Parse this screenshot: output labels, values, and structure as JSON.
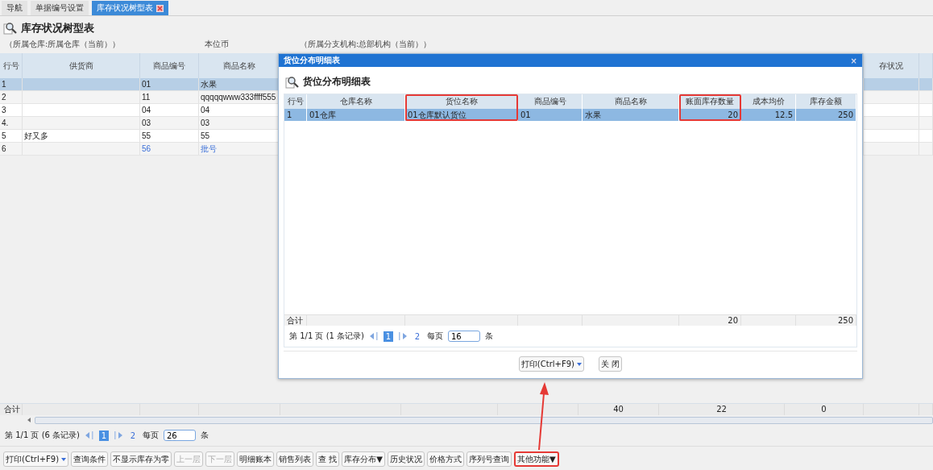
{
  "tabs": [
    {
      "label": "导航",
      "selected": false,
      "closable": false
    },
    {
      "label": "单据编号设置",
      "selected": false,
      "closable": false
    },
    {
      "label": "库存状况树型表",
      "selected": true,
      "closable": true
    }
  ],
  "page_title": "库存状况树型表",
  "filters": [
    "（所属仓库:所属仓库（当前））",
    "本位币",
    "（所属分支机构:总部机构（当前））"
  ],
  "main_table": {
    "columns": [
      {
        "label": "行号"
      },
      {
        "label": "供货商"
      },
      {
        "label": "商品编号"
      },
      {
        "label": "商品名称"
      },
      {},
      {},
      {},
      {},
      {},
      {},
      {
        "label": "存状况"
      },
      {}
    ],
    "rows": [
      {
        "cells": [
          "1",
          "",
          "01",
          "水果"
        ],
        "selected": true,
        "linked": false
      },
      {
        "cells": [
          "2",
          "",
          "11",
          "qqqqqwww333ffff555"
        ],
        "selected": false,
        "linked": false
      },
      {
        "cells": [
          "3",
          "",
          "04",
          "04"
        ],
        "selected": false,
        "linked": false
      },
      {
        "cells": [
          "4.",
          "",
          "03",
          "03"
        ],
        "selected": false,
        "linked": false
      },
      {
        "cells": [
          "5",
          "好又多",
          "55",
          "55"
        ],
        "selected": false,
        "linked": false
      },
      {
        "cells": [
          "6",
          "",
          "56",
          "批号"
        ],
        "selected": false,
        "linked": true
      }
    ],
    "totals": {
      "label": "合计",
      "values": [
        "40",
        "22",
        "0"
      ]
    }
  },
  "pager": {
    "summary": "第 1/1 页 (6 条记录)",
    "current_page": "1",
    "last_page": "2",
    "per_page_label": "每页",
    "per_page": "26",
    "unit": "条"
  },
  "buttons": [
    {
      "label": "打印(Ctrl+F9)",
      "kind": "menu",
      "disabled": false,
      "highlighted": false
    },
    {
      "label": "查询条件",
      "kind": "plain",
      "disabled": false,
      "highlighted": false
    },
    {
      "label": "不显示库存为零",
      "kind": "plain",
      "disabled": false,
      "highlighted": false
    },
    {
      "label": "上一层",
      "kind": "plain",
      "disabled": true,
      "highlighted": false
    },
    {
      "label": "下一层",
      "kind": "plain",
      "disabled": true,
      "highlighted": false
    },
    {
      "label": "明细账本",
      "kind": "plain",
      "disabled": false,
      "highlighted": false
    },
    {
      "label": "销售列表",
      "kind": "plain",
      "disabled": false,
      "highlighted": false
    },
    {
      "label": "查 找",
      "kind": "plain",
      "disabled": false,
      "highlighted": false
    },
    {
      "label": "库存分布▼",
      "kind": "plain",
      "disabled": false,
      "highlighted": false
    },
    {
      "label": "历史状况",
      "kind": "plain",
      "disabled": false,
      "highlighted": false
    },
    {
      "label": "价格方式",
      "kind": "plain",
      "disabled": false,
      "highlighted": false
    },
    {
      "label": "序列号查询",
      "kind": "plain",
      "disabled": false,
      "highlighted": false
    },
    {
      "label": "其他功能▼",
      "kind": "plain",
      "disabled": false,
      "highlighted": true
    }
  ],
  "dialog": {
    "title": "货位分布明细表",
    "close_label": "×",
    "heading": "货位分布明细表",
    "columns": [
      {
        "label": "行号",
        "highlighted": false,
        "kind": "text",
        "total": "合计"
      },
      {
        "label": "仓库名称",
        "highlighted": false,
        "kind": "text"
      },
      {
        "label": "货位名称",
        "highlighted": true,
        "kind": "text"
      },
      {
        "label": "商品编号",
        "highlighted": false,
        "kind": "text"
      },
      {
        "label": "商品名称",
        "highlighted": false,
        "kind": "text"
      },
      {
        "label": "账面库存数量",
        "highlighted": true,
        "kind": "number",
        "total": "20"
      },
      {
        "label": "成本均价",
        "highlighted": false,
        "kind": "number"
      },
      {
        "label": "库存金额",
        "highlighted": false,
        "kind": "number",
        "total": "250"
      }
    ],
    "rows": [
      {
        "cells": [
          "1",
          "01仓库",
          "01仓库默认货位",
          "01",
          "水果",
          "20",
          "12.5",
          "250"
        ],
        "selected": true
      }
    ],
    "pager": {
      "summary": "第 1/1 页 (1 条记录)",
      "current_page": "1",
      "last_page": "2",
      "per_page_label": "每页",
      "per_page": "16",
      "unit": "条"
    },
    "buttons": [
      {
        "label": "打印(Ctrl+F9)",
        "kind": "menu"
      },
      {
        "label": "关 闭",
        "kind": "plain"
      }
    ]
  }
}
